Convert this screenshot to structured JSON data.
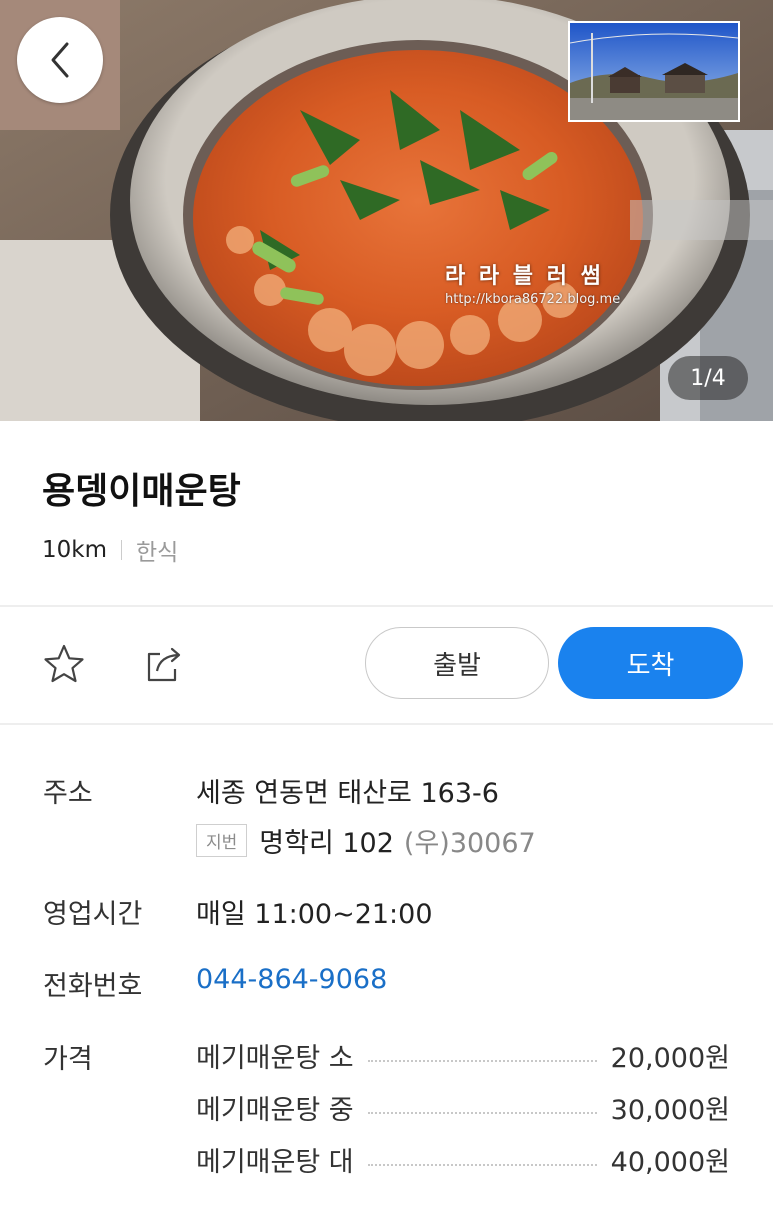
{
  "header": {
    "photo_counter": "1/4",
    "watermark_text": "라 라 블 러 썸",
    "watermark_url": "http://kbora86722.blog.me"
  },
  "place": {
    "name": "용뎅이매운탕",
    "distance": "10km",
    "category": "한식"
  },
  "actions": {
    "depart_label": "출발",
    "arrive_label": "도착"
  },
  "info": {
    "address_label": "주소",
    "address": "세종 연동면 태산로 163-6",
    "jibun_badge": "지번",
    "jibun_address": "명학리 102",
    "postal": "(우)30067",
    "hours_label": "영업시간",
    "hours": "매일 11:00~21:00",
    "phone_label": "전화번호",
    "phone": "044-864-9068",
    "price_label": "가격"
  },
  "menu": [
    {
      "name": "메기매운탕 소",
      "price": "20,000원"
    },
    {
      "name": "메기매운탕 중",
      "price": "30,000원"
    },
    {
      "name": "메기매운탕 대",
      "price": "40,000원"
    }
  ],
  "colors": {
    "accent": "#1a82ee",
    "phone_link": "#1a6fc7"
  },
  "icons": {
    "back": "chevron-left-icon",
    "favorite": "star-icon",
    "share": "share-icon"
  }
}
